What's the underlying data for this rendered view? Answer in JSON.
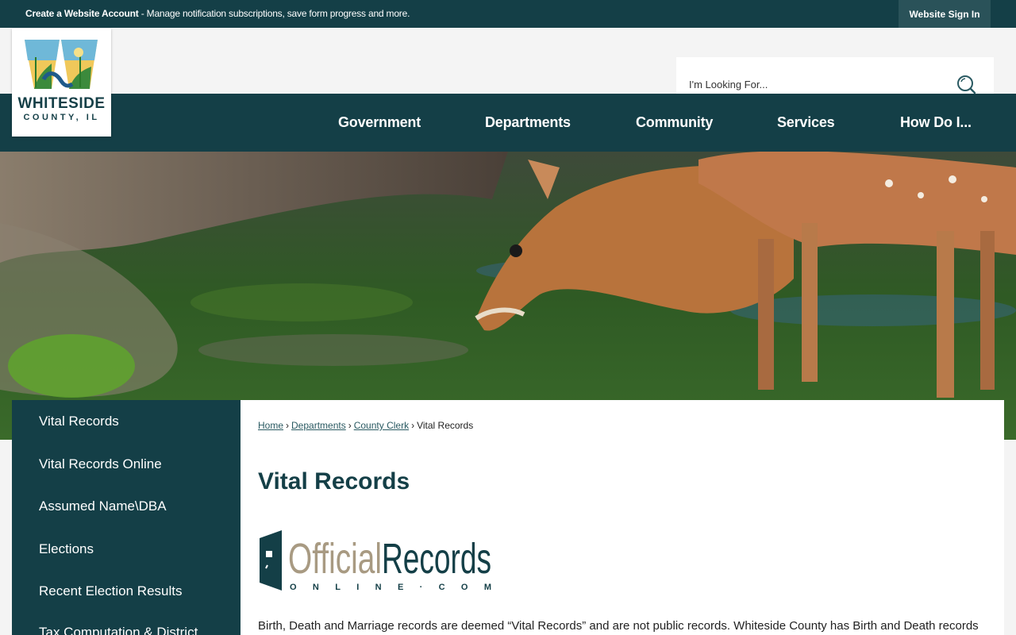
{
  "topbar": {
    "message_bold": "Create a Website Account",
    "message_rest": " - Manage notification subscriptions, save form progress and more.",
    "signin_label": "Website Sign In"
  },
  "logo": {
    "line1": "WHITESIDE",
    "line2": "COUNTY, IL"
  },
  "search": {
    "placeholder": "I'm Looking For..."
  },
  "nav": {
    "items": [
      "Government",
      "Departments",
      "Community",
      "Services",
      "How Do I..."
    ]
  },
  "sidebar": {
    "items": [
      "Vital Records",
      "Vital Records Online",
      "Assumed Name\\DBA",
      "Elections",
      "Recent Election Results",
      "Tax Computation & District"
    ]
  },
  "breadcrumb": {
    "items": [
      "Home",
      "Departments",
      "County Clerk"
    ],
    "current": "Vital Records"
  },
  "main": {
    "title": "Vital Records",
    "brand_official": "Official",
    "brand_records": "Records",
    "brand_sub": "ONLINE·COM",
    "intro": "Birth, Death and Marriage records are deemed “Vital Records” and are not public records. Whiteside County has Birth and Death records"
  },
  "colors": {
    "primary": "#143f47",
    "brand_tan": "#a89a82"
  }
}
